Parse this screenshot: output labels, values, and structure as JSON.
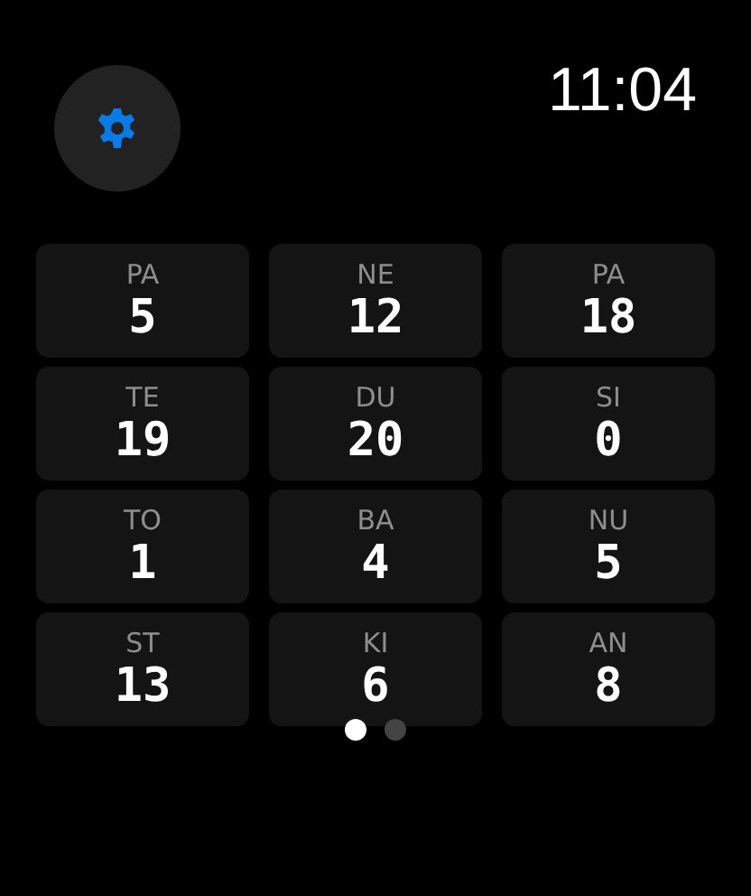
{
  "time": "11:04",
  "tiles": [
    {
      "label": "PA",
      "value": "5"
    },
    {
      "label": "NE",
      "value": "12"
    },
    {
      "label": "PA",
      "value": "18"
    },
    {
      "label": "TE",
      "value": "19"
    },
    {
      "label": "DU",
      "value": "20"
    },
    {
      "label": "SI",
      "value": "0"
    },
    {
      "label": "TO",
      "value": "1"
    },
    {
      "label": "BA",
      "value": "4"
    },
    {
      "label": "NU",
      "value": "5"
    },
    {
      "label": "ST",
      "value": "13"
    },
    {
      "label": "KI",
      "value": "6"
    },
    {
      "label": "AN",
      "value": "8"
    }
  ],
  "pages": [
    {
      "selected": true
    },
    {
      "selected": false
    }
  ]
}
